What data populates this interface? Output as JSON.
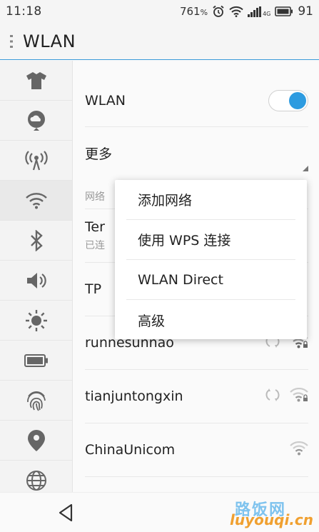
{
  "status_bar": {
    "time": "11:18",
    "speed": "761",
    "speed_unit": "%",
    "network": "4G",
    "battery": "91"
  },
  "app_bar": {
    "title": "WLAN"
  },
  "sidebar": {
    "items": [
      {
        "icon": "tshirt-icon"
      },
      {
        "icon": "cloud-icon"
      },
      {
        "icon": "hotspot-icon"
      },
      {
        "icon": "wifi-icon",
        "active": true
      },
      {
        "icon": "bluetooth-icon"
      },
      {
        "icon": "volume-icon"
      },
      {
        "icon": "brightness-icon"
      },
      {
        "icon": "battery-icon"
      },
      {
        "icon": "fingerprint-icon"
      },
      {
        "icon": "location-icon"
      },
      {
        "icon": "globe-icon"
      }
    ]
  },
  "main": {
    "wlan_label": "WLAN",
    "wlan_enabled": true,
    "more_label": "更多",
    "section_header": "网络",
    "networks": [
      {
        "name": "Ter",
        "status": "已连"
      },
      {
        "name": "TP"
      },
      {
        "name": "runnesunnao"
      },
      {
        "name": "tianjuntongxin"
      },
      {
        "name": "ChinaUnicom"
      }
    ]
  },
  "popup_menu": {
    "items": [
      "添加网络",
      "使用 WPS 连接",
      "WLAN Direct",
      "高级"
    ]
  },
  "watermark": {
    "cn": "路饭网",
    "en": "luyouqi.cn"
  },
  "colors": {
    "accent": "#2d9be0",
    "divider": "#3a9ad9"
  }
}
